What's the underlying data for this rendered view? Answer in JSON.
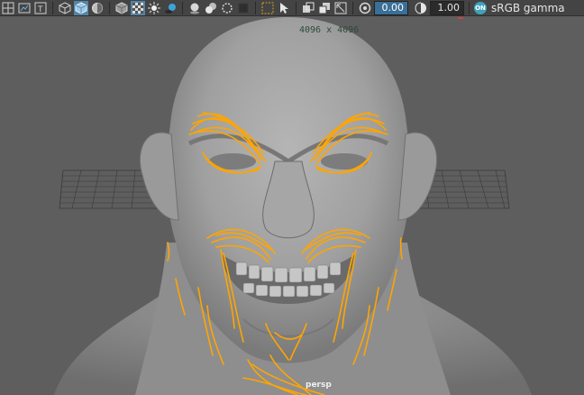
{
  "toolbar": {
    "icons": [
      "grid-icon",
      "film-gate-icon",
      "resolution-gate-icon",
      "wireframe-icon",
      "smooth-shade-icon",
      "flat-shade-icon",
      "bounding-box-icon",
      "textured-icon",
      "lights-icon",
      "shadows-icon",
      "ambient-occlusion-icon",
      "motion-blur-icon",
      "anti-aliasing-icon",
      "depth-of-field-icon",
      "isolate-select-icon",
      "xray-icon",
      "xray-joints-icon",
      "xray-components-icon",
      "gamma-icon",
      "exposure-icon"
    ],
    "exposure_value": "0.00",
    "gamma_value": "1.00",
    "color_space_badge": "ON",
    "color_space_label": "sRGB gamma"
  },
  "viewport": {
    "resolution_label": "4096 x 4096",
    "camera_label": "persp",
    "highlight_color": "#ffa500",
    "mesh_color": "#9a9a9a"
  }
}
